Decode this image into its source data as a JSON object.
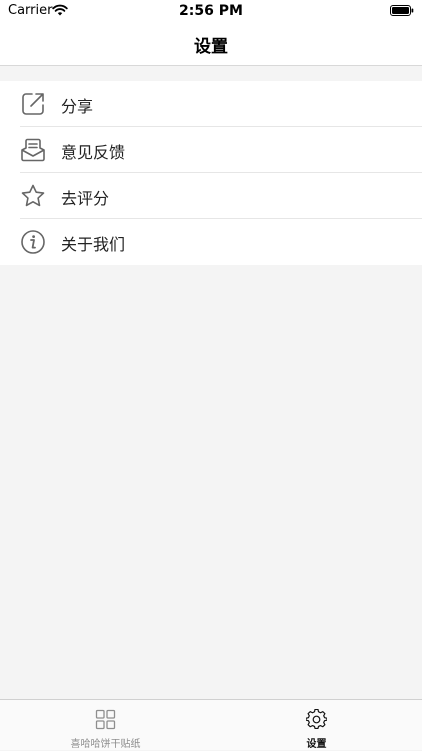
{
  "status_bar": {
    "carrier": "Carrier",
    "time": "2:56 PM"
  },
  "nav": {
    "title": "设置"
  },
  "settings": {
    "items": [
      {
        "label": "分享",
        "icon": "share-icon"
      },
      {
        "label": "意见反馈",
        "icon": "feedback-mail-icon"
      },
      {
        "label": "去评分",
        "icon": "star-icon"
      },
      {
        "label": "关于我们",
        "icon": "info-icon"
      }
    ]
  },
  "tabs": [
    {
      "label": "喜哈哈饼干贴纸",
      "icon": "grid-icon",
      "selected": false
    },
    {
      "label": "设置",
      "icon": "gear-icon",
      "selected": true
    }
  ],
  "colors": {
    "background": "#f4f4f4",
    "icon_gray": "#666666",
    "tab_inactive": "#8e8e8e",
    "tab_active": "#111111"
  }
}
